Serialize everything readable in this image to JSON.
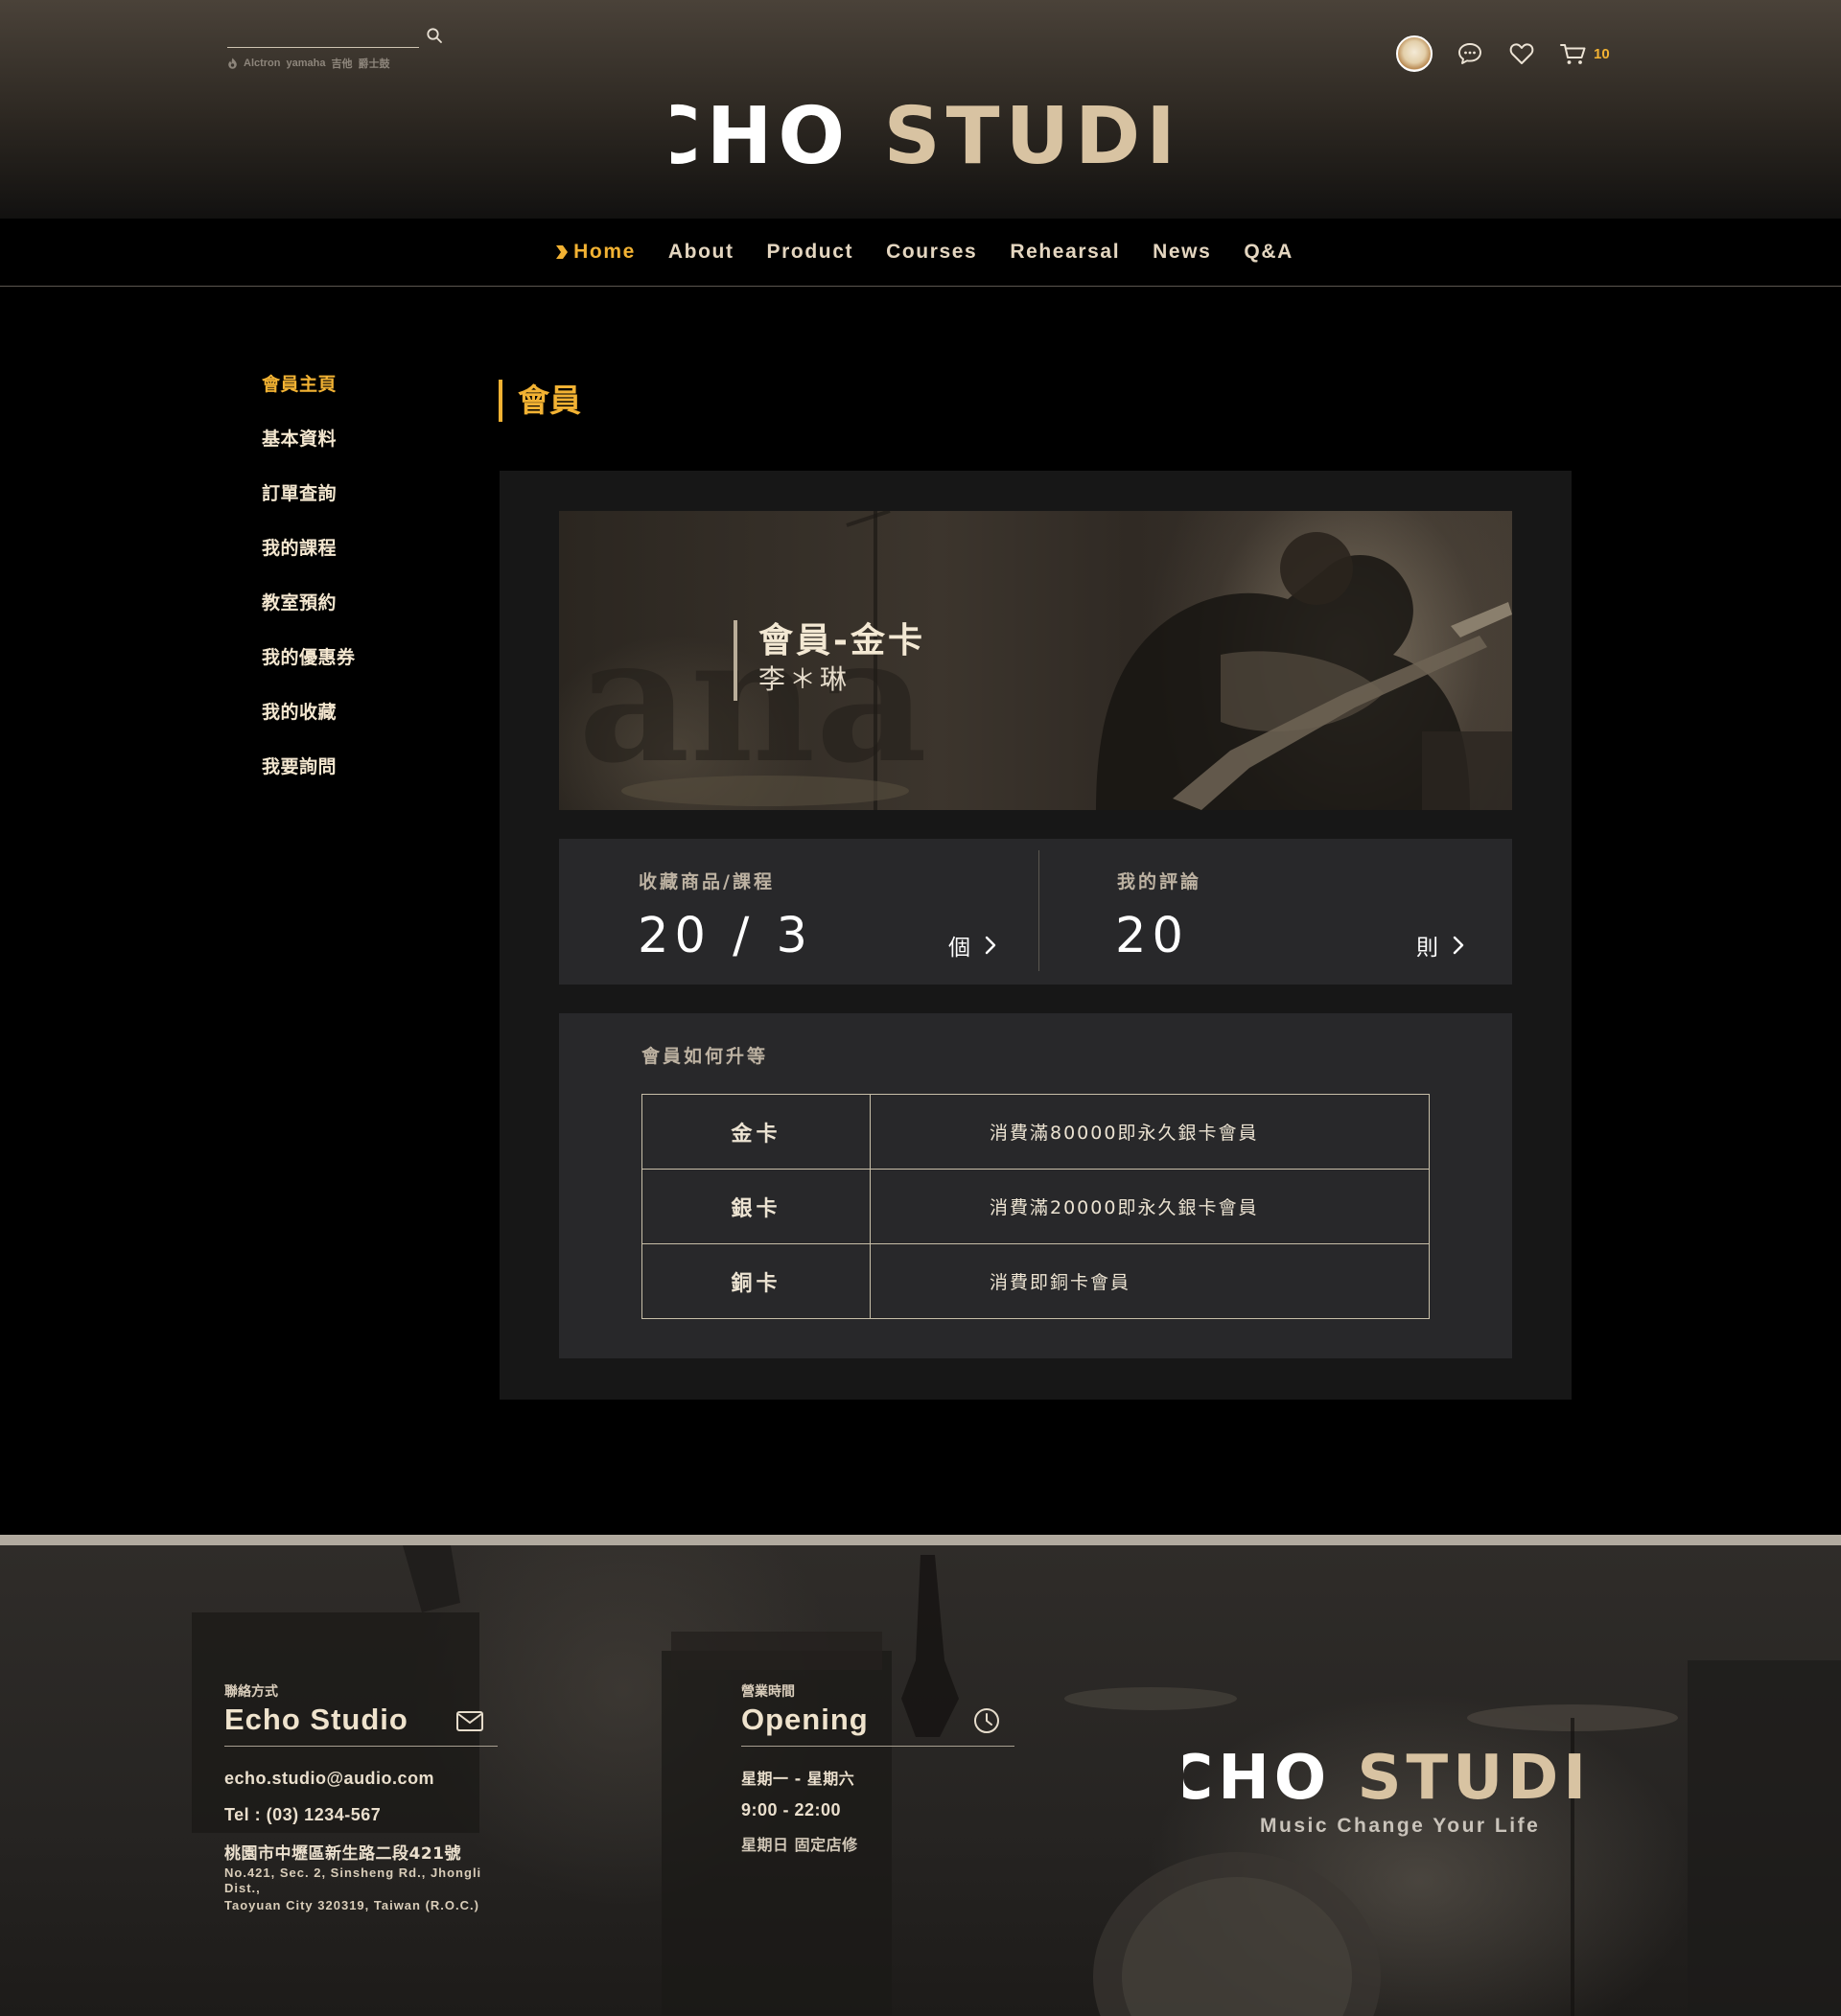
{
  "header": {
    "search": {
      "value": "",
      "placeholder": ""
    },
    "hot_tags": [
      "Alctron",
      "yamaha",
      "吉他",
      "爵士鼓"
    ],
    "cart_count": "10",
    "logo_text": "ECHO STUDIO"
  },
  "nav": {
    "items": [
      {
        "label": "Home",
        "active": true
      },
      {
        "label": "About"
      },
      {
        "label": "Product"
      },
      {
        "label": "Courses"
      },
      {
        "label": "Rehearsal"
      },
      {
        "label": "News"
      },
      {
        "label": "Q&A"
      }
    ]
  },
  "sidebar": {
    "items": [
      {
        "label": "會員主頁",
        "active": true
      },
      {
        "label": "基本資料"
      },
      {
        "label": "訂單查詢"
      },
      {
        "label": "我的課程"
      },
      {
        "label": "教室預約"
      },
      {
        "label": "我的優惠券"
      },
      {
        "label": "我的收藏"
      },
      {
        "label": "我要詢問"
      }
    ]
  },
  "main": {
    "title": "會員",
    "banner": {
      "tier_title": "會員-金卡",
      "member_name": "李＊琳"
    },
    "stats": [
      {
        "label": "收藏商品/課程",
        "value": "20 / 3",
        "unit": "個"
      },
      {
        "label": "我的評論",
        "value": "20",
        "unit": "則"
      }
    ],
    "upgrade": {
      "title": "會員如何升等",
      "rows": [
        {
          "tier": "金卡",
          "rule": "消費滿80000即永久銀卡會員"
        },
        {
          "tier": "銀卡",
          "rule": "消費滿20000即永久銀卡會員"
        },
        {
          "tier": "銅卡",
          "rule": " 消費即銅卡會員"
        }
      ]
    }
  },
  "footer": {
    "contact": {
      "label": "聯絡方式",
      "heading": "Echo Studio",
      "email": "echo.studio@audio.com",
      "tel": "Tel : (03) 1234-567",
      "address_zh": "桃園市中壢區新生路二段421號",
      "address_en_1": "No.421, Sec. 2, Sinsheng Rd., Jhongli Dist.,",
      "address_en_2": "Taoyuan City 320319, Taiwan (R.O.C.)"
    },
    "hours": {
      "label": "營業時間",
      "heading": "Opening",
      "days": "星期一 - 星期六",
      "time": "9:00 - 22:00",
      "closed": "星期日 固定店修"
    },
    "logo_text": "ECHO STUDIO",
    "slogan": "Music Change Your Life"
  },
  "colors": {
    "accent": "#f2b233",
    "cream": "#e9dcc8",
    "panel": "#171717",
    "card": "#28282a",
    "footer_bar": "#b1aa9f"
  },
  "icons": [
    "search-icon",
    "fire-icon",
    "avatar",
    "chat-icon",
    "heart-icon",
    "cart-icon",
    "chevron-right-icon",
    "mail-icon",
    "clock-icon"
  ]
}
